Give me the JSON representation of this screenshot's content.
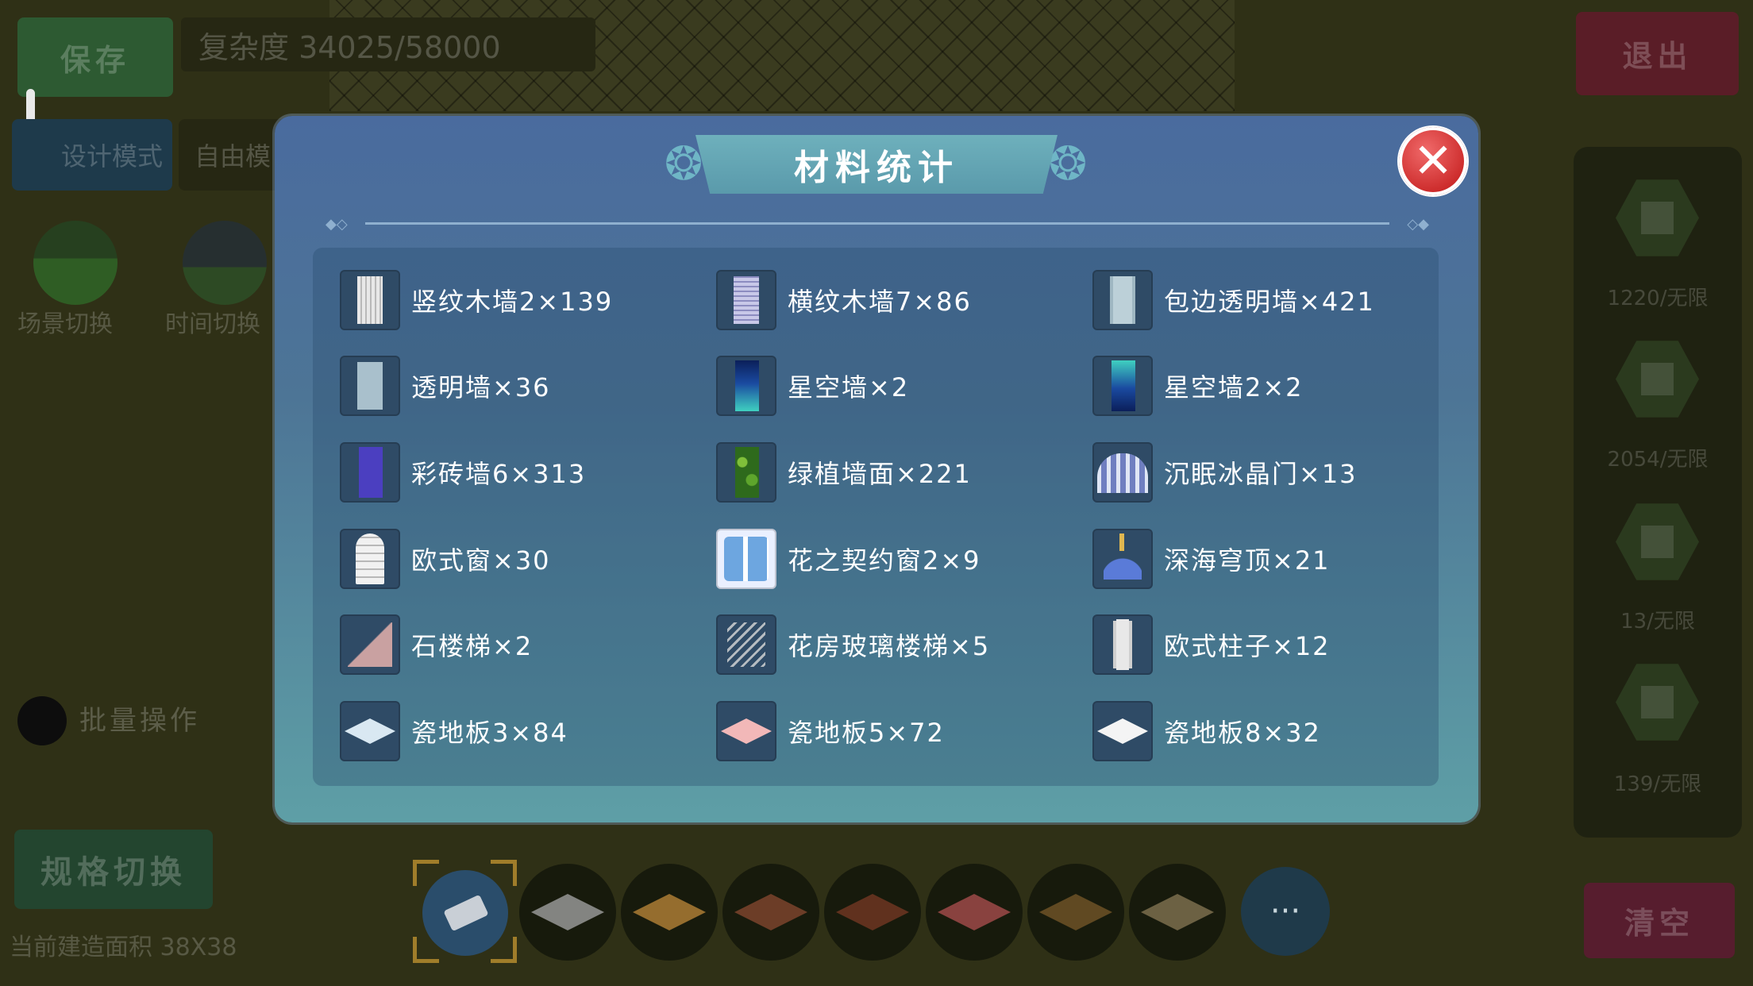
{
  "hud": {
    "save_label": "保存",
    "complexity_text": "复杂度 34025/58000",
    "exit_label": "退出",
    "design_mode_label": "设计模式",
    "free_mode_label": "自由模",
    "scene_switch_label": "场景切换",
    "time_switch_label": "时间切换",
    "batch_label": "批量操作",
    "spec_switch_label": "规格切换",
    "area_label": "当前建造面积 38X38",
    "clear_label": "清空",
    "more_label": "···"
  },
  "right_panel": {
    "counts": [
      "1220/无限",
      "2054/无限",
      "13/无限",
      "139/无限"
    ]
  },
  "bottom_tiles": {
    "colors": [
      "#a8a8a8",
      "#c08a3a",
      "#8a4a30",
      "#7a3a24",
      "#b05050",
      "#7a5a2a",
      "#8a7a55"
    ]
  },
  "modal": {
    "title": "材料统计",
    "close_icon": "close-icon",
    "items": [
      {
        "label": "竖纹木墙2×139",
        "icon": "vertical-wood-wall-icon"
      },
      {
        "label": "横纹木墙7×86",
        "icon": "horizontal-wood-wall-icon"
      },
      {
        "label": "包边透明墙×421",
        "icon": "edged-glass-wall-icon"
      },
      {
        "label": "透明墙×36",
        "icon": "glass-wall-icon"
      },
      {
        "label": "星空墙×2",
        "icon": "starry-wall-icon"
      },
      {
        "label": "星空墙2×2",
        "icon": "starry-wall-2-icon"
      },
      {
        "label": "彩砖墙6×313",
        "icon": "colored-brick-wall-icon"
      },
      {
        "label": "绿植墙面×221",
        "icon": "green-plant-wall-icon"
      },
      {
        "label": "沉眠冰晶门×13",
        "icon": "ice-crystal-door-icon"
      },
      {
        "label": "欧式窗×30",
        "icon": "european-window-icon"
      },
      {
        "label": "花之契约窗2×9",
        "icon": "flower-window-icon"
      },
      {
        "label": "深海穹顶×21",
        "icon": "deep-sea-dome-icon"
      },
      {
        "label": "石楼梯×2",
        "icon": "stone-stairs-icon"
      },
      {
        "label": "花房玻璃楼梯×5",
        "icon": "glass-stairs-icon"
      },
      {
        "label": "欧式柱子×12",
        "icon": "european-pillar-icon"
      },
      {
        "label": "瓷地板3×84",
        "icon": "tile-floor-3-icon",
        "color": "#d9e8f2"
      },
      {
        "label": "瓷地板5×72",
        "icon": "tile-floor-5-icon",
        "color": "#f2b8b8"
      },
      {
        "label": "瓷地板8×32",
        "icon": "tile-floor-8-icon",
        "color": "#f4f4f4"
      }
    ]
  }
}
